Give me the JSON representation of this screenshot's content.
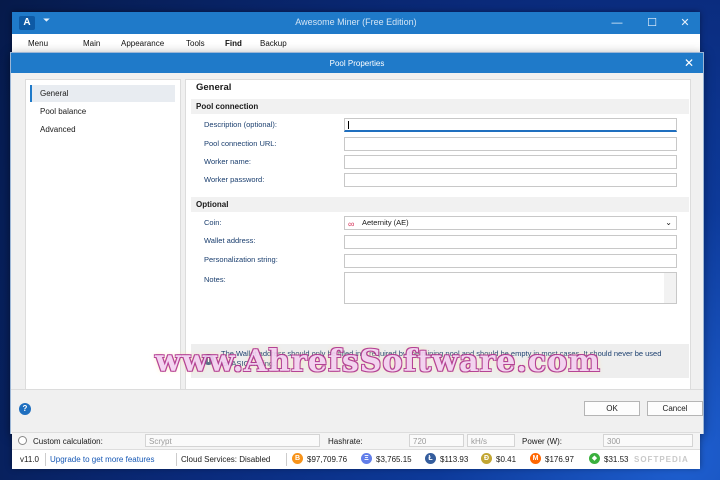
{
  "window": {
    "title": "Awesome Miner (Free Edition)",
    "logo_letter": "A",
    "quick_access": "⏷",
    "minimize": "—",
    "maximize": "☐",
    "close": "✕"
  },
  "menu": [
    "Menu",
    "Main",
    "Appearance",
    "Tools",
    "Find",
    "Backup"
  ],
  "dialog": {
    "title": "Pool Properties",
    "close": "✕",
    "nav": [
      "General",
      "Pool balance",
      "Advanced"
    ],
    "heading": "General",
    "sections": {
      "pool_connection": "Pool connection",
      "optional": "Optional"
    },
    "fields": {
      "description": {
        "label": "Description (optional):",
        "value": ""
      },
      "pool_url": {
        "label": "Pool connection URL:",
        "value": ""
      },
      "worker_name": {
        "label": "Worker name:",
        "value": ""
      },
      "worker_password": {
        "label": "Worker password:",
        "value": ""
      },
      "coin": {
        "label": "Coin:",
        "value": "Aeternity (AE)"
      },
      "wallet": {
        "label": "Wallet address:",
        "value": ""
      },
      "personalization": {
        "label": "Personalization string:",
        "value": ""
      },
      "notes": {
        "label": "Notes:",
        "value": ""
      }
    },
    "info_text": "The Wallet address should only be filled in if required by the mining pool and should be empty in most cases. It should never be used for ASIC mining.",
    "ok": "OK",
    "cancel": "Cancel",
    "help": "?"
  },
  "calc_row": {
    "custom_calc": "Custom calculation:",
    "algo": "Scrypt",
    "hashrate_label": "Hashrate:",
    "hashrate_value": "720",
    "hashrate_unit": "kH/s",
    "power_label": "Power (W):",
    "power_value": "300"
  },
  "status": {
    "version": "v11.0",
    "upgrade": "Upgrade to get more features",
    "cloud": "Cloud Services: Disabled",
    "prices": [
      {
        "symbol": "B",
        "value": "$97,709.76",
        "color": "#f7931a"
      },
      {
        "symbol": "Ξ",
        "value": "$3,765.15",
        "color": "#627eea"
      },
      {
        "symbol": "Ł",
        "value": "$113.93",
        "color": "#345d9d"
      },
      {
        "symbol": "Ð",
        "value": "$0.41",
        "color": "#c2a633"
      },
      {
        "symbol": "M",
        "value": "$176.97",
        "color": "#ff6600"
      },
      {
        "symbol": "◆",
        "value": "$31.53",
        "color": "#3ab03e"
      }
    ],
    "softpedia": "SOFTPEDIA"
  },
  "watermark": "www.AhrefsSoftware.com"
}
